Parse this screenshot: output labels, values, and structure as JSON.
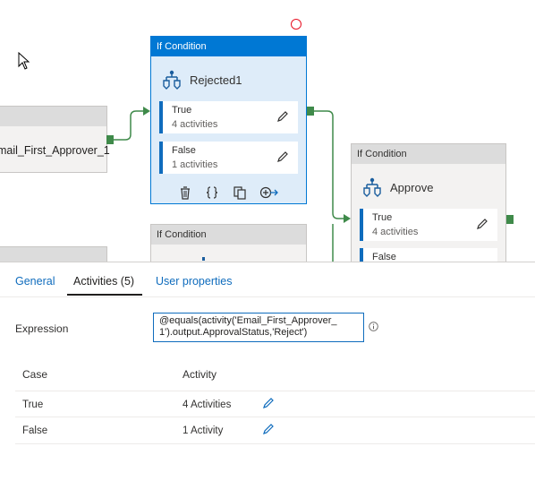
{
  "canvas": {
    "left_node": {
      "label": "mail_First_Approver_1"
    },
    "selected_node": {
      "header": "If Condition",
      "title": "Rejected1",
      "branches": [
        {
          "name": "True",
          "count": "4 activities"
        },
        {
          "name": "False",
          "count": "1 activities"
        }
      ],
      "toolbar_icons": [
        "delete-icon",
        "code-icon",
        "copy-icon",
        "add-output-icon"
      ]
    },
    "approve_node": {
      "header": "If Condition",
      "title": "Approve",
      "branches": [
        {
          "name": "True",
          "count": "4 activities"
        },
        {
          "name": "False",
          "count": ""
        }
      ]
    },
    "lower_node": {
      "header": "If Condition"
    },
    "colors": {
      "accent": "#0078d4",
      "connector": "#3f8a4a",
      "selection_bg": "#deecf9"
    }
  },
  "panel": {
    "tabs": [
      {
        "label": "General"
      },
      {
        "label": "Activities (5)"
      },
      {
        "label": "User properties"
      }
    ],
    "active_tab": "Activities (5)",
    "expression": {
      "label": "Expression",
      "value": "@equals(activity('Email_First_Approver_\n1').output.ApprovalStatus,'Reject')"
    },
    "table": {
      "headers": {
        "case": "Case",
        "activity": "Activity"
      },
      "rows": [
        {
          "case": "True",
          "activity": "4 Activities"
        },
        {
          "case": "False",
          "activity": "1 Activity"
        }
      ]
    }
  }
}
